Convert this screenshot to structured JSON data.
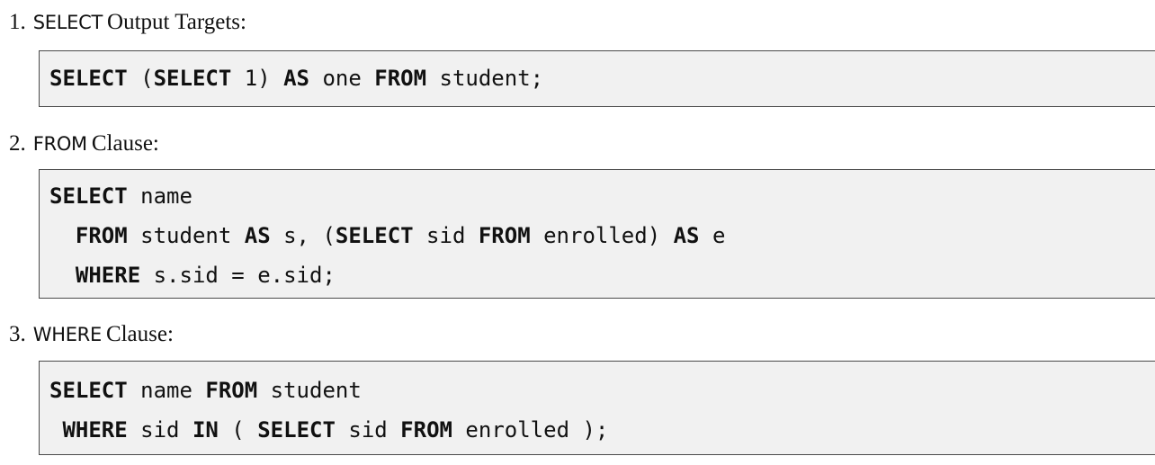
{
  "items": [
    {
      "number": "1.",
      "keyword": "SELECT",
      "title": "Output Targets:",
      "code_lines": [
        [
          {
            "t": "SELECT",
            "kw": true
          },
          {
            "t": " (",
            "kw": false
          },
          {
            "t": "SELECT",
            "kw": true
          },
          {
            "t": " 1) ",
            "kw": false
          },
          {
            "t": "AS",
            "kw": true
          },
          {
            "t": " one ",
            "kw": false
          },
          {
            "t": "FROM",
            "kw": true
          },
          {
            "t": " student;",
            "kw": false
          }
        ]
      ]
    },
    {
      "number": "2.",
      "keyword": "FROM",
      "title": "Clause:",
      "code_lines": [
        [
          {
            "t": "SELECT",
            "kw": true
          },
          {
            "t": " name",
            "kw": false
          }
        ],
        [
          {
            "t": "  ",
            "kw": false
          },
          {
            "t": "FROM",
            "kw": true
          },
          {
            "t": " student ",
            "kw": false
          },
          {
            "t": "AS",
            "kw": true
          },
          {
            "t": " s, (",
            "kw": false
          },
          {
            "t": "SELECT",
            "kw": true
          },
          {
            "t": " sid ",
            "kw": false
          },
          {
            "t": "FROM",
            "kw": true
          },
          {
            "t": " enrolled) ",
            "kw": false
          },
          {
            "t": "AS",
            "kw": true
          },
          {
            "t": " e",
            "kw": false
          }
        ],
        [
          {
            "t": "  ",
            "kw": false
          },
          {
            "t": "WHERE",
            "kw": true
          },
          {
            "t": " s.sid = e.sid;",
            "kw": false
          }
        ]
      ]
    },
    {
      "number": "3.",
      "keyword": "WHERE",
      "title": "Clause:",
      "code_lines": [
        [
          {
            "t": "SELECT",
            "kw": true
          },
          {
            "t": " name ",
            "kw": false
          },
          {
            "t": "FROM",
            "kw": true
          },
          {
            "t": " student",
            "kw": false
          }
        ],
        [
          {
            "t": " ",
            "kw": false
          },
          {
            "t": "WHERE",
            "kw": true
          },
          {
            "t": " sid ",
            "kw": false
          },
          {
            "t": "IN",
            "kw": true
          },
          {
            "t": " ( ",
            "kw": false
          },
          {
            "t": "SELECT",
            "kw": true
          },
          {
            "t": " sid ",
            "kw": false
          },
          {
            "t": "FROM",
            "kw": true
          },
          {
            "t": " enrolled );",
            "kw": false
          }
        ]
      ]
    }
  ]
}
